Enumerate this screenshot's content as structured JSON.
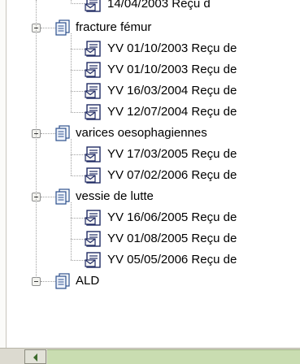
{
  "tree": {
    "top_partial": "14/04/2003 Reçu d",
    "groups": [
      {
        "label": "fracture fémur",
        "items": [
          "YV 01/10/2003 Reçu de",
          "YV 01/10/2003 Reçu de",
          "YV 16/03/2004 Reçu de",
          "YV 12/07/2004 Reçu de"
        ]
      },
      {
        "label": "varices oesophagiennes",
        "items": [
          "YV 17/03/2005 Reçu de",
          "YV 07/02/2006 Reçu de"
        ]
      },
      {
        "label": "vessie de lutte",
        "items": [
          "YV 16/06/2005 Reçu de",
          "YV 01/08/2005 Reçu de",
          "YV 05/05/2006 Reçu de"
        ]
      },
      {
        "label": "ALD",
        "items": []
      }
    ]
  },
  "icons": {
    "group": "folder-document-icon",
    "item": "document-envelope-icon",
    "expander": "minus-icon",
    "scroll": "scroll-left-arrow-icon"
  },
  "colors": {
    "background": "#ffffff",
    "statusbar": "#dcdad0",
    "scroll_track": "#c9ddb1"
  }
}
